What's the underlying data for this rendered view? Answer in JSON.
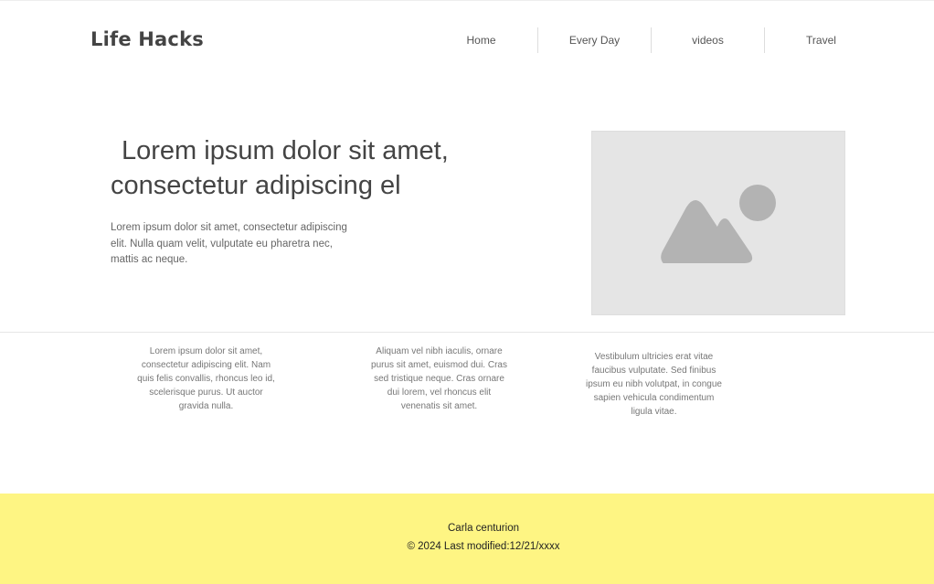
{
  "header": {
    "logo": "Life Hacks",
    "nav": [
      {
        "label": "Home"
      },
      {
        "label": "Every Day"
      },
      {
        "label": "videos"
      },
      {
        "label": "Travel"
      }
    ]
  },
  "hero": {
    "title_line1": "Lorem ipsum dolor sit amet,",
    "title_line2": "consectetur adipiscing el",
    "text": "Lorem ipsum dolor sit amet, consectetur adipiscing elit. Nulla quam velit, vulputate eu pharetra nec, mattis ac neque.",
    "image_icon": "image-placeholder-icon"
  },
  "columns": [
    {
      "text": "Lorem ipsum dolor sit amet, consectetur adipiscing elit. Nam quis felis convallis, rhoncus leo id, scelerisque purus. Ut auctor gravida nulla."
    },
    {
      "text": "Aliquam vel nibh iaculis, ornare purus sit amet, euismod dui. Cras sed tristique neque. Cras ornare dui lorem, vel rhoncus elit venenatis sit amet."
    },
    {
      "text": "Vestibulum ultricies erat vitae faucibus vulputate. Sed finibus ipsum eu nibh volutpat, in congue sapien vehicula condimentum ligula vitae."
    }
  ],
  "footer": {
    "name": "Carla centurion",
    "copyright": "© 2024 Last modified:12/21/xxxx",
    "background": "#fef583"
  }
}
